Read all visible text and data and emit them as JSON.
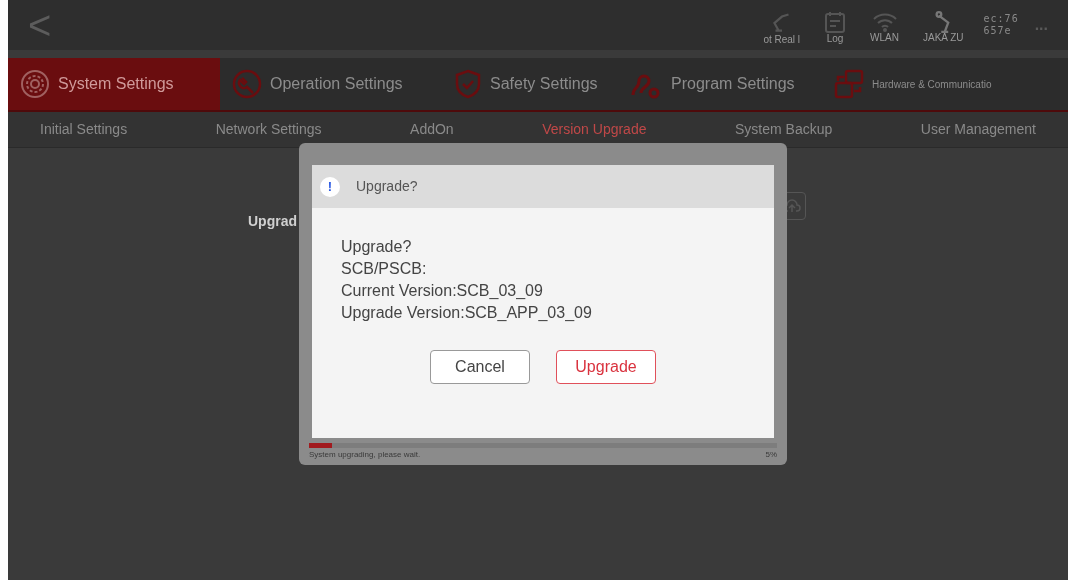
{
  "top_bar": {
    "back": "<",
    "status_items": [
      {
        "kind": "robot",
        "label": "ot Real l"
      },
      {
        "kind": "log",
        "label": "Log"
      },
      {
        "kind": "wifi",
        "label": "WLAN"
      },
      {
        "kind": "arm",
        "label": "JAKA ZU"
      }
    ],
    "id_lines": [
      "ec:76",
      "657e"
    ],
    "more": "..."
  },
  "main_tabs": [
    {
      "label": "System Settings",
      "selected": true
    },
    {
      "label": "Operation Settings",
      "selected": false
    },
    {
      "label": "Safety Settings",
      "selected": false
    },
    {
      "label": "Program Settings",
      "selected": false
    },
    {
      "label": "Hardware & Communicatio",
      "selected": false
    }
  ],
  "sub_tabs": [
    {
      "label": "Initial Settings",
      "selected": false
    },
    {
      "label": "Network Settings",
      "selected": false
    },
    {
      "label": "AddOn",
      "selected": false
    },
    {
      "label": "Version Upgrade",
      "selected": true
    },
    {
      "label": "System Backup",
      "selected": false
    },
    {
      "label": "User Management",
      "selected": false
    }
  ],
  "content": {
    "label": "Upgrad"
  },
  "progress_panel": {
    "status": "System upgrading, please wait.",
    "level": 0.05,
    "percent": "5%"
  },
  "dialog": {
    "icon": "!",
    "title": "Upgrade?",
    "message_lines": [
      "Upgrade?",
      "SCB/PSCB:",
      "Current Version:SCB_03_09",
      "Upgrade Version:SCB_APP_03_09"
    ],
    "buttons": [
      {
        "label": "Cancel",
        "kind": "secondary"
      },
      {
        "label": "Upgrade",
        "kind": "primary"
      }
    ]
  }
}
